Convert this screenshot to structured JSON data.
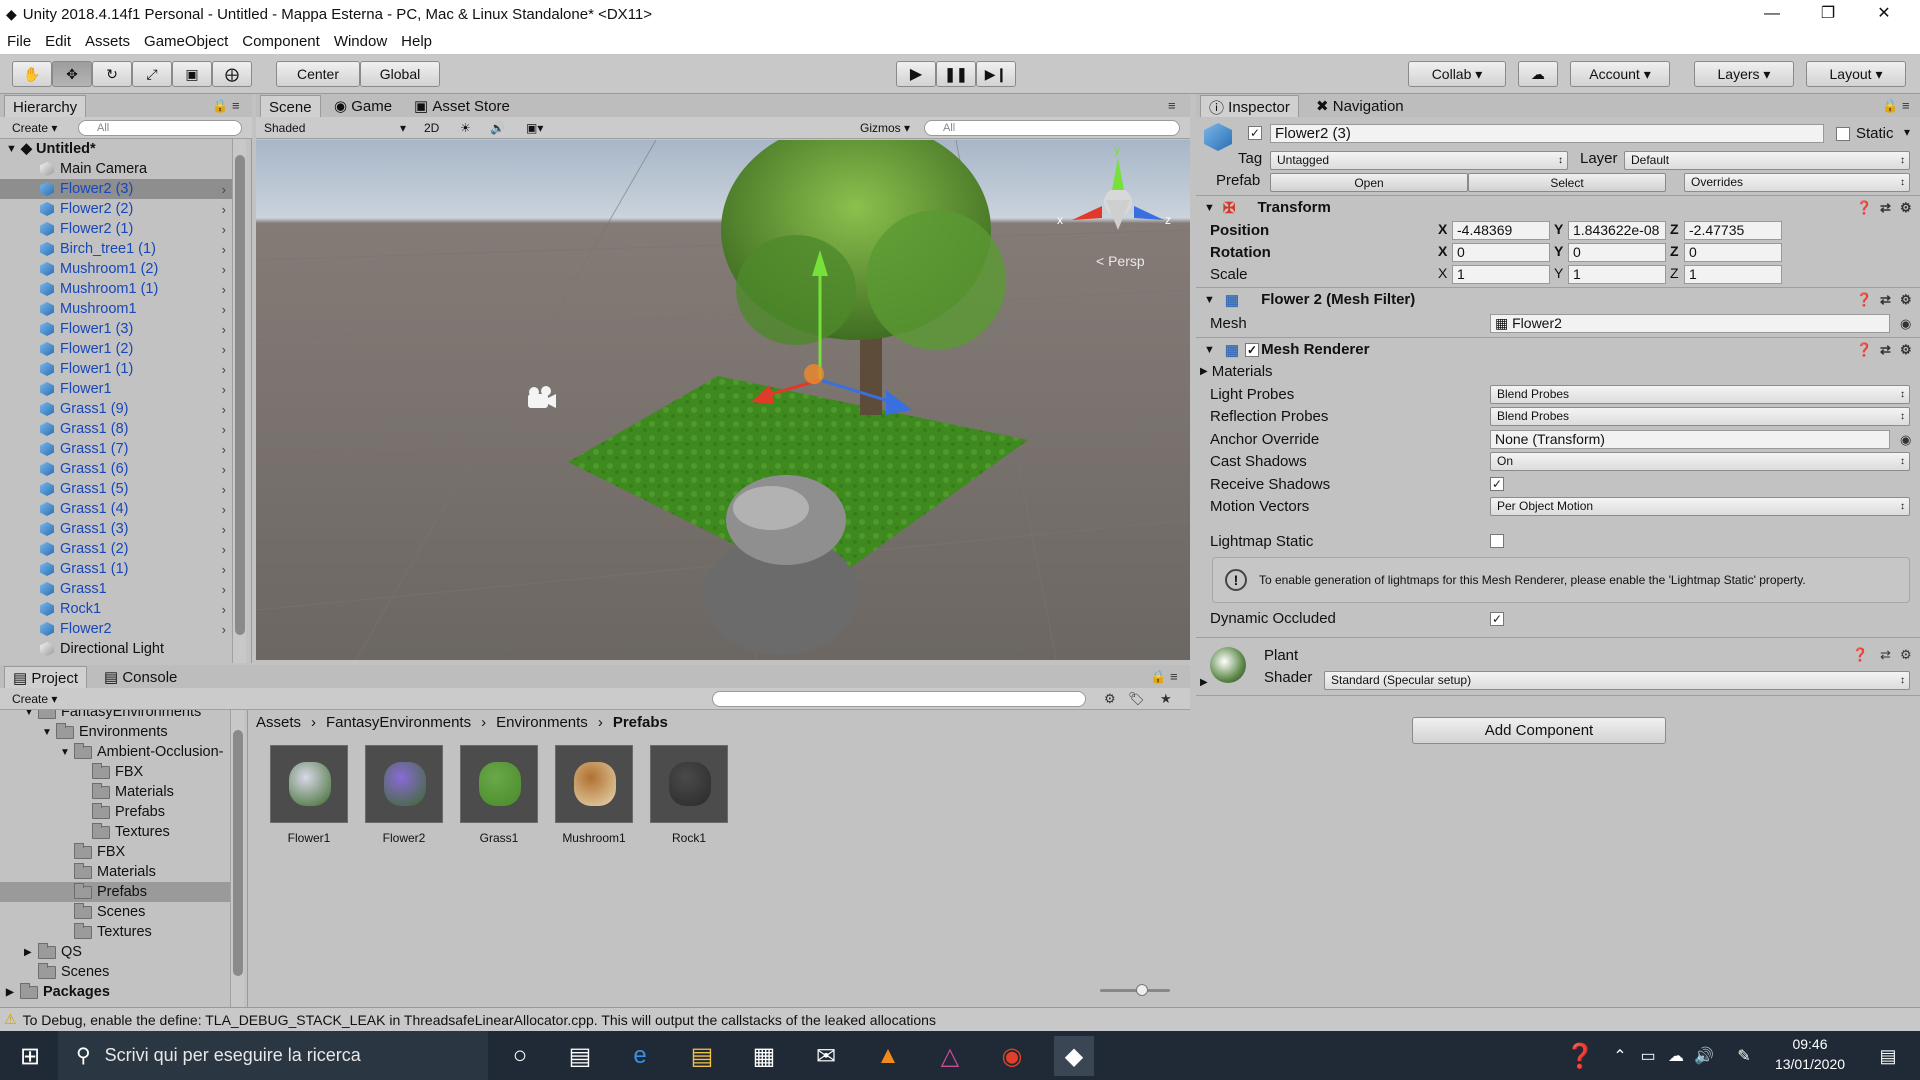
{
  "window": {
    "title": "Unity 2018.4.14f1 Personal - Untitled - Mappa Esterna - PC, Mac & Linux Standalone* <DX11>",
    "min": "—",
    "max": "❐",
    "close": "✕"
  },
  "menu": [
    "File",
    "Edit",
    "Assets",
    "GameObject",
    "Component",
    "Window",
    "Help"
  ],
  "toolbar": {
    "center": "Center",
    "global": "Global",
    "collab": "Collab",
    "account": "Account",
    "layers": "Layers",
    "layout": "Layout"
  },
  "hierarchy": {
    "tab": "Hierarchy",
    "create": "Create",
    "search": "All",
    "root": "Untitled*",
    "items": [
      {
        "name": "Main Camera",
        "blue": false
      },
      {
        "name": "Flower2 (3)",
        "blue": true,
        "sel": true
      },
      {
        "name": "Flower2 (2)",
        "blue": true
      },
      {
        "name": "Flower2 (1)",
        "blue": true
      },
      {
        "name": "Birch_tree1 (1)",
        "blue": true
      },
      {
        "name": "Mushroom1 (2)",
        "blue": true
      },
      {
        "name": "Mushroom1 (1)",
        "blue": true
      },
      {
        "name": "Mushroom1",
        "blue": true
      },
      {
        "name": "Flower1 (3)",
        "blue": true
      },
      {
        "name": "Flower1 (2)",
        "blue": true
      },
      {
        "name": "Flower1 (1)",
        "blue": true
      },
      {
        "name": "Flower1",
        "blue": true
      },
      {
        "name": "Grass1 (9)",
        "blue": true
      },
      {
        "name": "Grass1 (8)",
        "blue": true
      },
      {
        "name": "Grass1 (7)",
        "blue": true
      },
      {
        "name": "Grass1 (6)",
        "blue": true
      },
      {
        "name": "Grass1 (5)",
        "blue": true
      },
      {
        "name": "Grass1 (4)",
        "blue": true
      },
      {
        "name": "Grass1 (3)",
        "blue": true
      },
      {
        "name": "Grass1 (2)",
        "blue": true
      },
      {
        "name": "Grass1 (1)",
        "blue": true
      },
      {
        "name": "Grass1",
        "blue": true
      },
      {
        "name": "Rock1",
        "blue": true
      },
      {
        "name": "Flower2",
        "blue": true
      },
      {
        "name": "Directional Light",
        "blue": false
      }
    ]
  },
  "scene": {
    "tabs": [
      "Scene",
      "Game",
      "Asset Store"
    ],
    "shading": "Shaded",
    "mode2d": "2D",
    "gizmos": "Gizmos",
    "search": "All",
    "persp": "Persp",
    "axis_x": "x",
    "axis_y": "y",
    "axis_z": "z"
  },
  "inspector": {
    "tabs": [
      "Inspector",
      "Navigation"
    ],
    "object_name": "Flower2 (3)",
    "static": "Static",
    "tag_label": "Tag",
    "tag": "Untagged",
    "layer_label": "Layer",
    "layer": "Default",
    "prefab_label": "Prefab",
    "open": "Open",
    "select": "Select",
    "overrides": "Overrides",
    "transform": {
      "title": "Transform",
      "position_label": "Position",
      "rotation_label": "Rotation",
      "scale_label": "Scale",
      "position": [
        "-4.48369",
        "1.843622e-08",
        "-2.47735"
      ],
      "rotation": [
        "0",
        "0",
        "0"
      ],
      "scale": [
        "1",
        "1",
        "1"
      ],
      "axes": [
        "X",
        "Y",
        "Z"
      ]
    },
    "mesh_filter": {
      "title": "Flower 2 (Mesh Filter)",
      "mesh_label": "Mesh",
      "mesh": "Flower2"
    },
    "mesh_renderer": {
      "title": "Mesh Renderer",
      "materials": "Materials",
      "light_probes_label": "Light Probes",
      "light_probes": "Blend Probes",
      "reflection_probes_label": "Reflection Probes",
      "reflection_probes": "Blend Probes",
      "anchor_override_label": "Anchor Override",
      "anchor_override": "None (Transform)",
      "cast_shadows_label": "Cast Shadows",
      "cast_shadows": "On",
      "receive_shadows_label": "Receive Shadows",
      "motion_vectors_label": "Motion Vectors",
      "motion_vectors": "Per Object Motion",
      "lightmap_static_label": "Lightmap Static",
      "info": "To enable generation of lightmaps for this Mesh Renderer, please enable the 'Lightmap Static' property.",
      "dynamic_occluded_label": "Dynamic Occluded"
    },
    "material": {
      "name": "Plant",
      "shader_label": "Shader",
      "shader": "Standard (Specular setup)"
    },
    "add_component": "Add Component"
  },
  "project": {
    "tabs": [
      "Project",
      "Console"
    ],
    "create": "Create",
    "tree": [
      {
        "label": "FantasyEnvironments",
        "level": 1,
        "arrow": "▼"
      },
      {
        "label": "Environments",
        "level": 2,
        "arrow": "▼"
      },
      {
        "label": "Ambient-Occlusion-",
        "level": 3,
        "arrow": "▼"
      },
      {
        "label": "FBX",
        "level": 4,
        "arrow": ""
      },
      {
        "label": "Materials",
        "level": 4,
        "arrow": ""
      },
      {
        "label": "Prefabs",
        "level": 4,
        "arrow": ""
      },
      {
        "label": "Textures",
        "level": 4,
        "arrow": ""
      },
      {
        "label": "FBX",
        "level": 3,
        "arrow": ""
      },
      {
        "label": "Materials",
        "level": 3,
        "arrow": ""
      },
      {
        "label": "Prefabs",
        "level": 3,
        "arrow": "",
        "sel": true
      },
      {
        "label": "Scenes",
        "level": 3,
        "arrow": ""
      },
      {
        "label": "Textures",
        "level": 3,
        "arrow": ""
      },
      {
        "label": "QS",
        "level": 1,
        "arrow": "▶"
      },
      {
        "label": "Scenes",
        "level": 1,
        "arrow": ""
      },
      {
        "label": "Packages",
        "level": 0,
        "arrow": "▶",
        "bold": true
      }
    ],
    "breadcrumb": [
      "Assets",
      "FantasyEnvironments",
      "Environments",
      "Prefabs"
    ],
    "assets": [
      "Flower1",
      "Flower2",
      "Grass1",
      "Mushroom1",
      "Rock1"
    ]
  },
  "status": "To Debug, enable the define: TLA_DEBUG_STACK_LEAK in ThreadsafeLinearAllocator.cpp. This will output the callstacks of the leaked allocations",
  "taskbar": {
    "search": "Scrivi qui per eseguire la ricerca",
    "time": "09:46",
    "date": "13/01/2020"
  }
}
